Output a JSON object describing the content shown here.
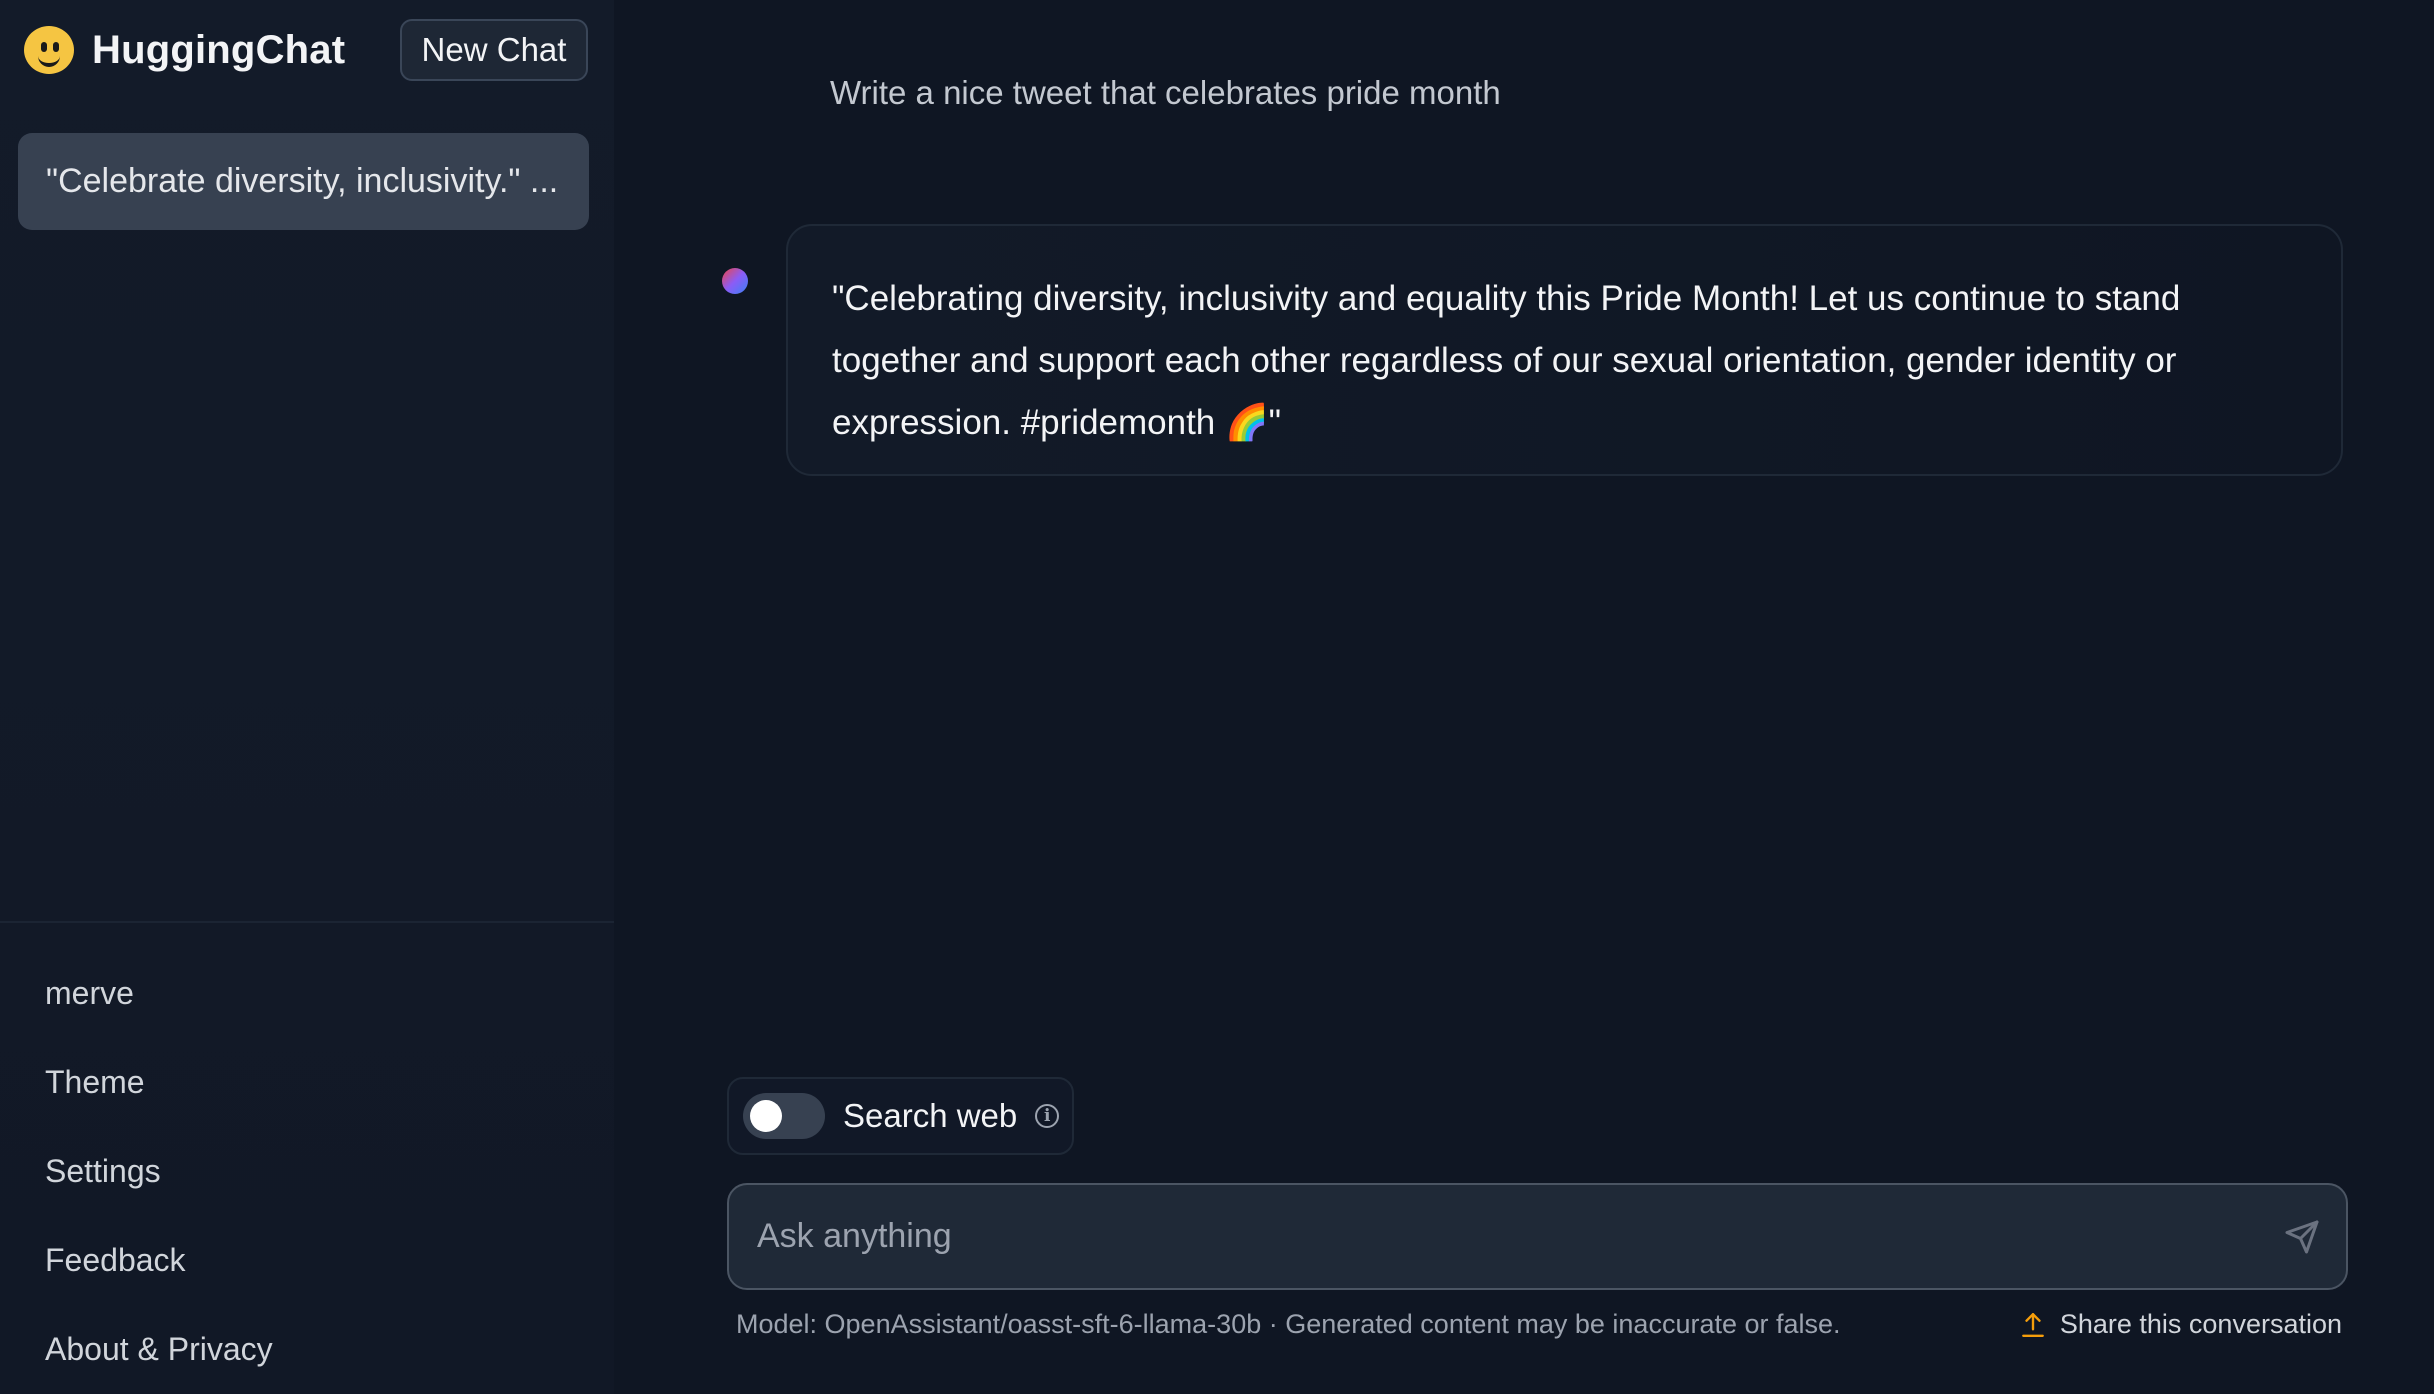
{
  "brand": {
    "title": "HuggingChat",
    "logo_icon": "hugging-face-smiley-icon"
  },
  "header": {
    "new_chat_label": "New Chat"
  },
  "sidebar": {
    "conversations": [
      {
        "title": "\"Celebrate diversity, inclusivity.\" ..."
      }
    ],
    "nav": [
      {
        "label": "merve"
      },
      {
        "label": "Theme"
      },
      {
        "label": "Settings"
      },
      {
        "label": "Feedback"
      },
      {
        "label": "About & Privacy"
      }
    ]
  },
  "conversation": {
    "user_message": "Write a nice tweet that celebrates pride month",
    "assistant_message": "\"Celebrating diversity, inclusivity and equality this Pride Month! Let us continue to stand together and support each other regardless of our sexual orientation, gender identity or expression. #pridemonth 🌈\""
  },
  "composer": {
    "search_web_label": "Search web",
    "search_web_enabled": false,
    "placeholder": "Ask anything",
    "send_icon": "paper-plane-icon"
  },
  "footer": {
    "model_note": "Model: OpenAssistant/oasst-sft-6-llama-30b · Generated content may be inaccurate or false.",
    "share_label": "Share this conversation",
    "share_icon": "upload-arrow-icon"
  },
  "colors": {
    "background": "#0f1623",
    "sidebar": "#131b29",
    "accent_logo": "#f5c542",
    "share_icon": "#f59e0b"
  }
}
